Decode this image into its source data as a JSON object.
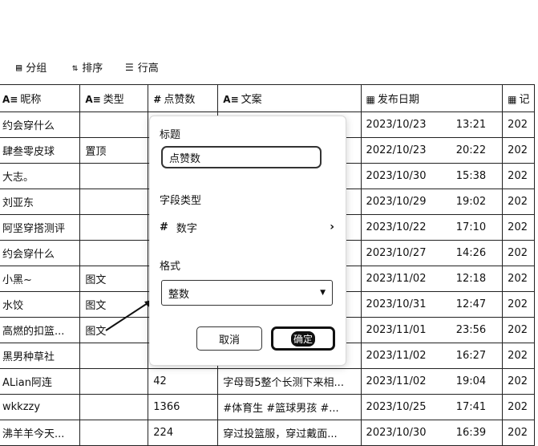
{
  "toolbar": {
    "items": [
      {
        "label": "分组",
        "icon": "group-icon"
      },
      {
        "label": "排序",
        "icon": "sort-icon"
      },
      {
        "label": "行高",
        "icon": "row-height-icon"
      }
    ]
  },
  "table": {
    "columns": [
      {
        "label": "昵称",
        "icon": "text-field-icon"
      },
      {
        "label": "类型",
        "icon": "text-field-icon"
      },
      {
        "label": "点赞数",
        "icon": "number-field-icon"
      },
      {
        "label": "文案",
        "icon": "text-field-icon"
      },
      {
        "label": "发布日期",
        "icon": "date-field-icon"
      },
      {
        "label": "记",
        "icon": "date-field-icon"
      }
    ],
    "rows": [
      {
        "nickname": "约会穿什么",
        "type": "",
        "likes": "",
        "copy": "..",
        "date": "2023/10/23",
        "time": "13:21",
        "extra": "202"
      },
      {
        "nickname": "肆叁零皮球",
        "type": "置顶",
        "likes": "",
        "copy": "..",
        "date": "2022/10/23",
        "time": "20:22",
        "extra": "202"
      },
      {
        "nickname": "大志。",
        "type": "",
        "likes": "",
        "copy": "..",
        "date": "2023/10/30",
        "time": "15:38",
        "extra": "202"
      },
      {
        "nickname": "刘亚东",
        "type": "",
        "likes": "",
        "copy": "..",
        "date": "2023/10/29",
        "time": "19:02",
        "extra": "202"
      },
      {
        "nickname": "阿坚穿搭测评",
        "type": "",
        "likes": "",
        "copy": "..",
        "date": "2023/10/22",
        "time": "17:10",
        "extra": "202"
      },
      {
        "nickname": "约会穿什么",
        "type": "",
        "likes": "",
        "copy": "..",
        "date": "2023/10/27",
        "time": "14:26",
        "extra": "202"
      },
      {
        "nickname": "小黑~",
        "type": "图文",
        "likes": "",
        "copy": "..",
        "date": "2023/11/02",
        "time": "12:18",
        "extra": "202"
      },
      {
        "nickname": "水饺",
        "type": "图文",
        "likes": "",
        "copy": "..",
        "date": "2023/10/31",
        "time": "12:47",
        "extra": "202"
      },
      {
        "nickname": "高燃的扣篮...",
        "type": "图文",
        "likes": "",
        "copy": "..",
        "date": "2023/11/01",
        "time": "23:56",
        "extra": "202"
      },
      {
        "nickname": "黑男种草社",
        "type": "",
        "likes": "",
        "copy": "..",
        "date": "2023/11/02",
        "time": "16:27",
        "extra": "202"
      },
      {
        "nickname": "ALian阿连",
        "type": "",
        "likes": "42",
        "copy": "字母哥5整个长测下来相...",
        "date": "2023/11/02",
        "time": "19:04",
        "extra": "202"
      },
      {
        "nickname": "wkkzzy",
        "type": "",
        "likes": "1366",
        "copy": "#体育生 #篮球男孩 #...",
        "date": "2023/10/25",
        "time": "17:41",
        "extra": "202"
      },
      {
        "nickname": "沸羊羊今天...",
        "type": "",
        "likes": "224",
        "copy": "穿过投篮服，穿过戴面...",
        "date": "2023/10/30",
        "time": "16:39",
        "extra": "202"
      }
    ]
  },
  "dialog": {
    "title_label": "标题",
    "title_value": "点赞数",
    "field_type_label": "字段类型",
    "field_type_value": "数字",
    "format_label": "格式",
    "format_value": "整数",
    "cancel_label": "取消",
    "confirm_label": "确定"
  }
}
